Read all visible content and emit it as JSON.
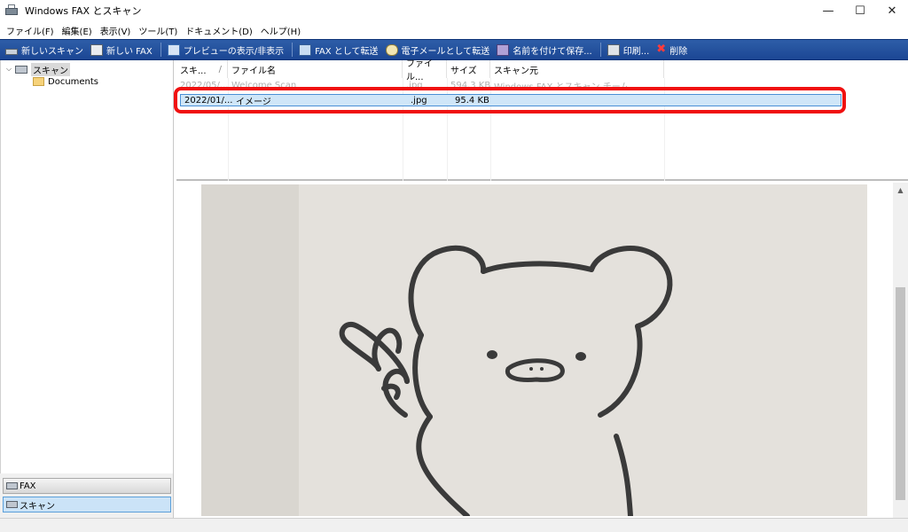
{
  "window": {
    "title": "Windows FAX とスキャン",
    "controls": {
      "minimize": "—",
      "maximize": "☐",
      "close": "✕"
    }
  },
  "menu": [
    "ファイル(F)",
    "編集(E)",
    "表示(V)",
    "ツール(T)",
    "ドキュメント(D)",
    "ヘルプ(H)"
  ],
  "toolbar": {
    "new_scan": "新しいスキャン",
    "new_fax": "新しい FAX",
    "toggle_preview": "プレビューの表示/非表示",
    "forward_fax": "FAX として転送",
    "forward_email": "電子メールとして転送",
    "save_as": "名前を付けて保存...",
    "print": "印刷...",
    "delete": "削除",
    "delete_icon": "✖"
  },
  "tree": {
    "root": "スキャン",
    "child": "Documents"
  },
  "nav": {
    "fax": "FAX",
    "scan": "スキャン"
  },
  "list": {
    "headers": [
      "スキ...",
      "ファイル名",
      "ファイル...",
      "サイズ",
      "スキャン元"
    ],
    "sort_indicator": "/",
    "rows": [
      {
        "date": "2022/05/...",
        "name": "Welcome Scan",
        "type": ".jpg",
        "size": "594.3 KB",
        "source": "Windows FAX とスキャン チーム"
      },
      {
        "date": "2022/01/...",
        "name": "イメージ",
        "type": ".jpg",
        "size": "95.4 KB",
        "source": ""
      }
    ],
    "selected_index": 1
  },
  "colors": {
    "toolbar": "#1b4694",
    "highlight": "#f01010",
    "selection": "#cfe6f8"
  }
}
